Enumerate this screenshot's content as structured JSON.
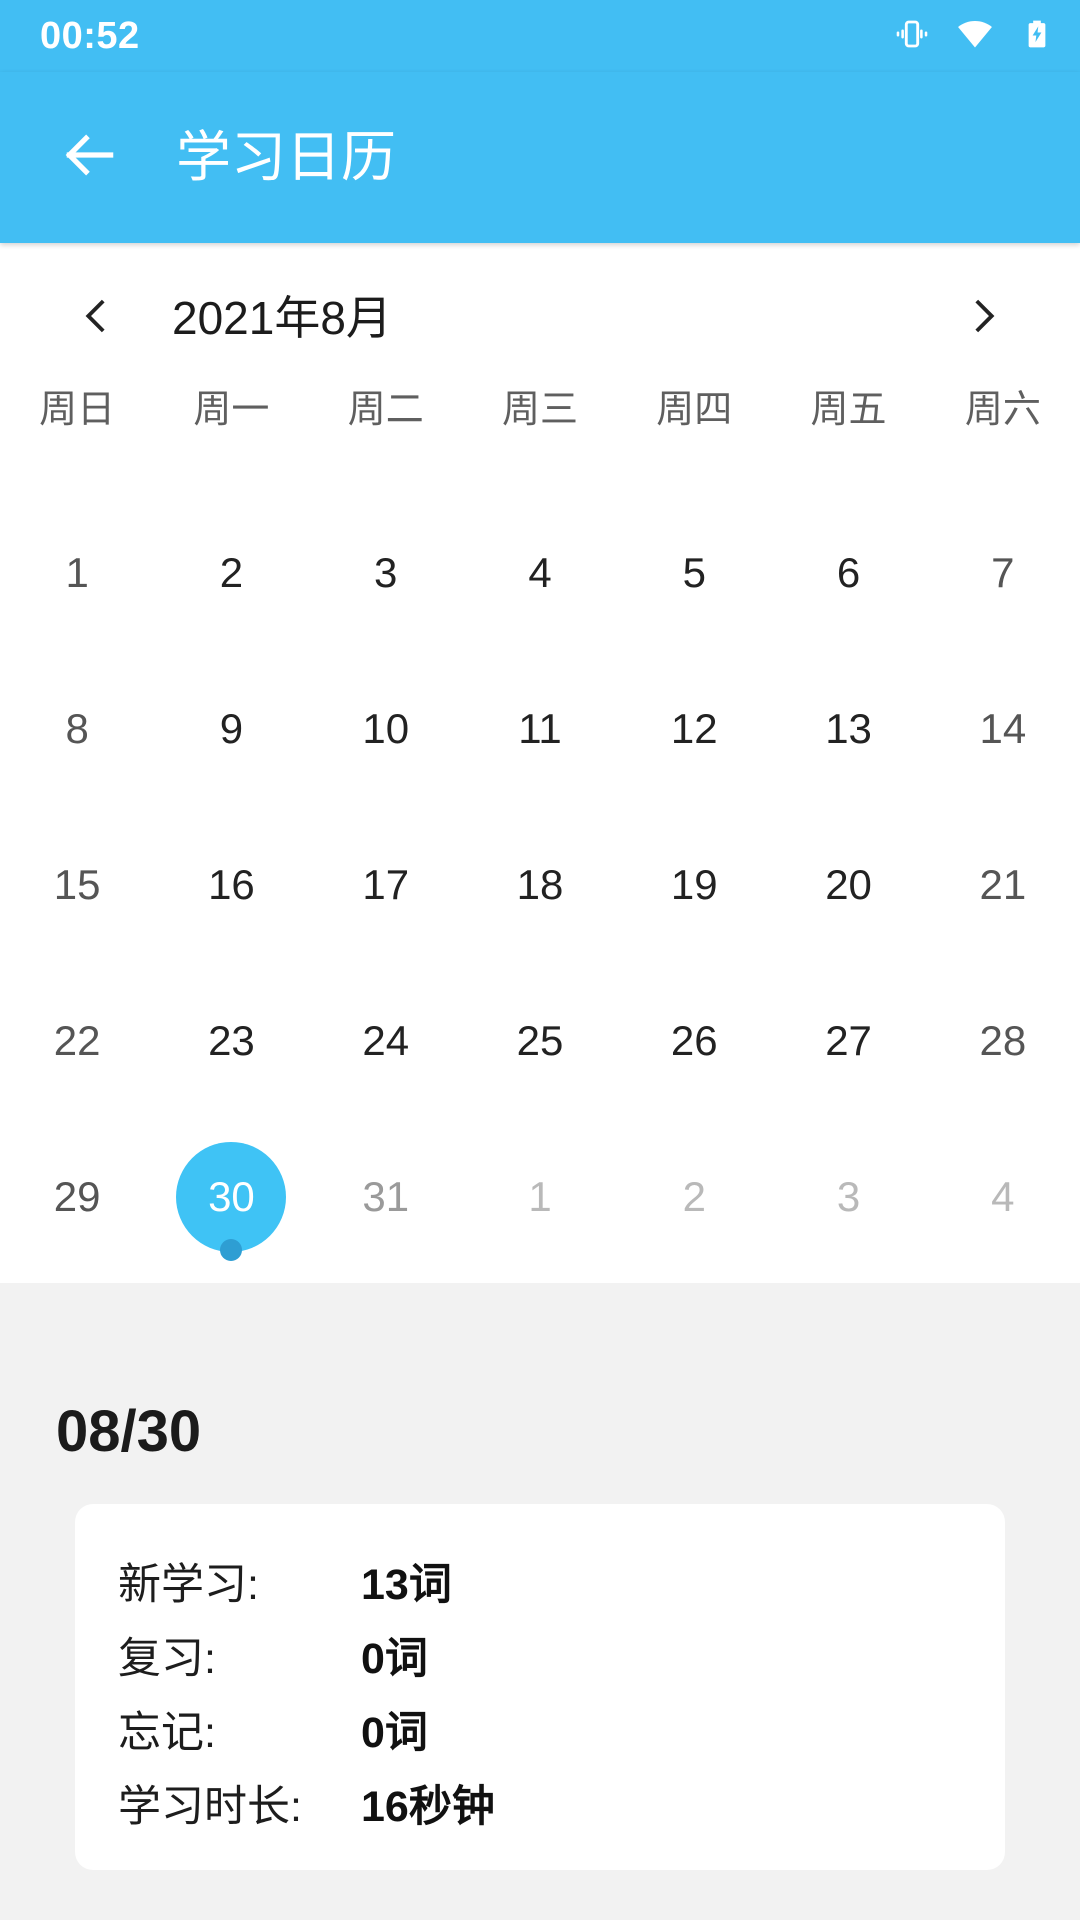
{
  "theme": {
    "accent": "#42bef3",
    "selected_circle": "#3fc3f5",
    "marker_dot": "#2e9ed3",
    "page_bg": "#f2f2f2",
    "card_bg": "#ffffff"
  },
  "statusbar": {
    "time": "00:52",
    "icons": [
      {
        "name": "vibrate-icon",
        "label": "vibrate"
      },
      {
        "name": "wifi-icon",
        "label": "wifi"
      },
      {
        "name": "battery-charging-icon",
        "label": "battery charging"
      }
    ]
  },
  "appbar": {
    "back_icon": "arrow-left-icon",
    "title": "学习日历"
  },
  "calendar": {
    "prev_icon": "chevron-left-icon",
    "next_icon": "chevron-right-icon",
    "month_label": "2021年8月",
    "weekdays": [
      "周日",
      "周一",
      "周二",
      "周三",
      "周四",
      "周五",
      "周六"
    ],
    "weeks": [
      [
        {
          "day": "1",
          "state": "sun"
        },
        {
          "day": "2",
          "state": "normal"
        },
        {
          "day": "3",
          "state": "normal"
        },
        {
          "day": "4",
          "state": "normal"
        },
        {
          "day": "5",
          "state": "normal"
        },
        {
          "day": "6",
          "state": "normal"
        },
        {
          "day": "7",
          "state": "sat"
        }
      ],
      [
        {
          "day": "8",
          "state": "sun"
        },
        {
          "day": "9",
          "state": "normal"
        },
        {
          "day": "10",
          "state": "normal"
        },
        {
          "day": "11",
          "state": "normal"
        },
        {
          "day": "12",
          "state": "normal"
        },
        {
          "day": "13",
          "state": "normal"
        },
        {
          "day": "14",
          "state": "sat"
        }
      ],
      [
        {
          "day": "15",
          "state": "sun"
        },
        {
          "day": "16",
          "state": "normal"
        },
        {
          "day": "17",
          "state": "normal"
        },
        {
          "day": "18",
          "state": "normal"
        },
        {
          "day": "19",
          "state": "normal"
        },
        {
          "day": "20",
          "state": "normal"
        },
        {
          "day": "21",
          "state": "sat"
        }
      ],
      [
        {
          "day": "22",
          "state": "sun"
        },
        {
          "day": "23",
          "state": "normal"
        },
        {
          "day": "24",
          "state": "normal"
        },
        {
          "day": "25",
          "state": "normal"
        },
        {
          "day": "26",
          "state": "normal"
        },
        {
          "day": "27",
          "state": "normal"
        },
        {
          "day": "28",
          "state": "sat"
        }
      ],
      [
        {
          "day": "29",
          "state": "sun"
        },
        {
          "day": "30",
          "state": "selected",
          "marker": true
        },
        {
          "day": "31",
          "state": "muted"
        },
        {
          "day": "1",
          "state": "dim"
        },
        {
          "day": "2",
          "state": "dim"
        },
        {
          "day": "3",
          "state": "dim"
        },
        {
          "day": "4",
          "state": "dim"
        }
      ]
    ]
  },
  "detail": {
    "date_label": "08/30",
    "stats": [
      {
        "label": "新学习:",
        "value": "13词"
      },
      {
        "label": "复习:",
        "value": "0词"
      },
      {
        "label": "忘记:",
        "value": "0词"
      },
      {
        "label": "学习时长:",
        "value": "16秒钟"
      }
    ]
  }
}
